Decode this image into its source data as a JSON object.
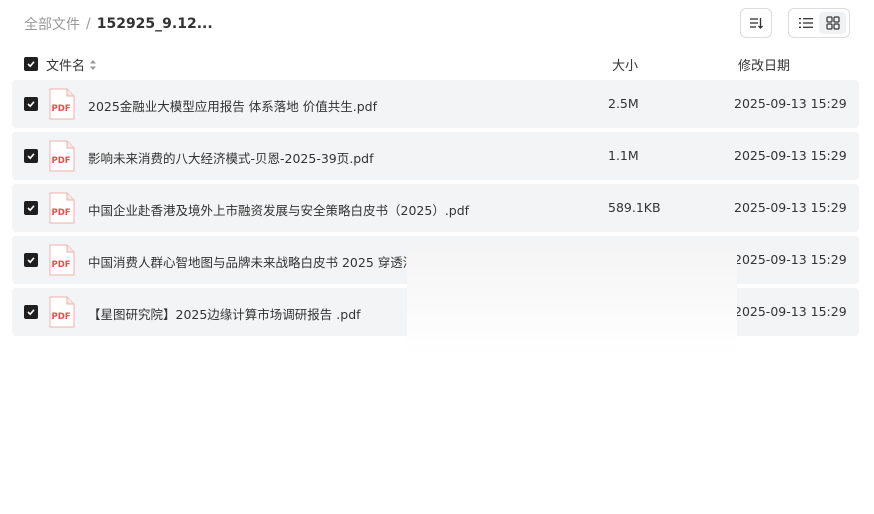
{
  "breadcrumb": {
    "root": "全部文件",
    "separator": "/",
    "current": "152925_9.12..."
  },
  "table": {
    "headers": {
      "name": "文件名",
      "size": "大小",
      "date": "修改日期"
    },
    "rows": [
      {
        "name": "2025金融业大模型应用报告 体系落地 价值共生.pdf",
        "size": "2.5M",
        "date": "2025-09-13 15:29"
      },
      {
        "name": "影响未来消费的八大经济模式-贝恩-2025-39页.pdf",
        "size": "1.1M",
        "date": "2025-09-13 15:29"
      },
      {
        "name": "中国企业赴香港及境外上市融资发展与安全策略白皮书（2025）.pdf",
        "size": "589.1KB",
        "date": "2025-09-13 15:29"
      },
      {
        "name": "中国消费人群心智地图与品牌未来战略白皮书 2025 穿透消费",
        "size": "",
        "date": "2025-09-13 15:29"
      },
      {
        "name": "【星图研究院】2025边缘计算市场调研报告 .pdf",
        "size": "",
        "date": "2025-09-13 15:29"
      }
    ]
  },
  "icons": {
    "file_type_label": "PDF"
  },
  "colors": {
    "row_bg": "#f3f4f5",
    "pdf_red": "#e0514a",
    "checkbox": "#1f1f1f"
  }
}
